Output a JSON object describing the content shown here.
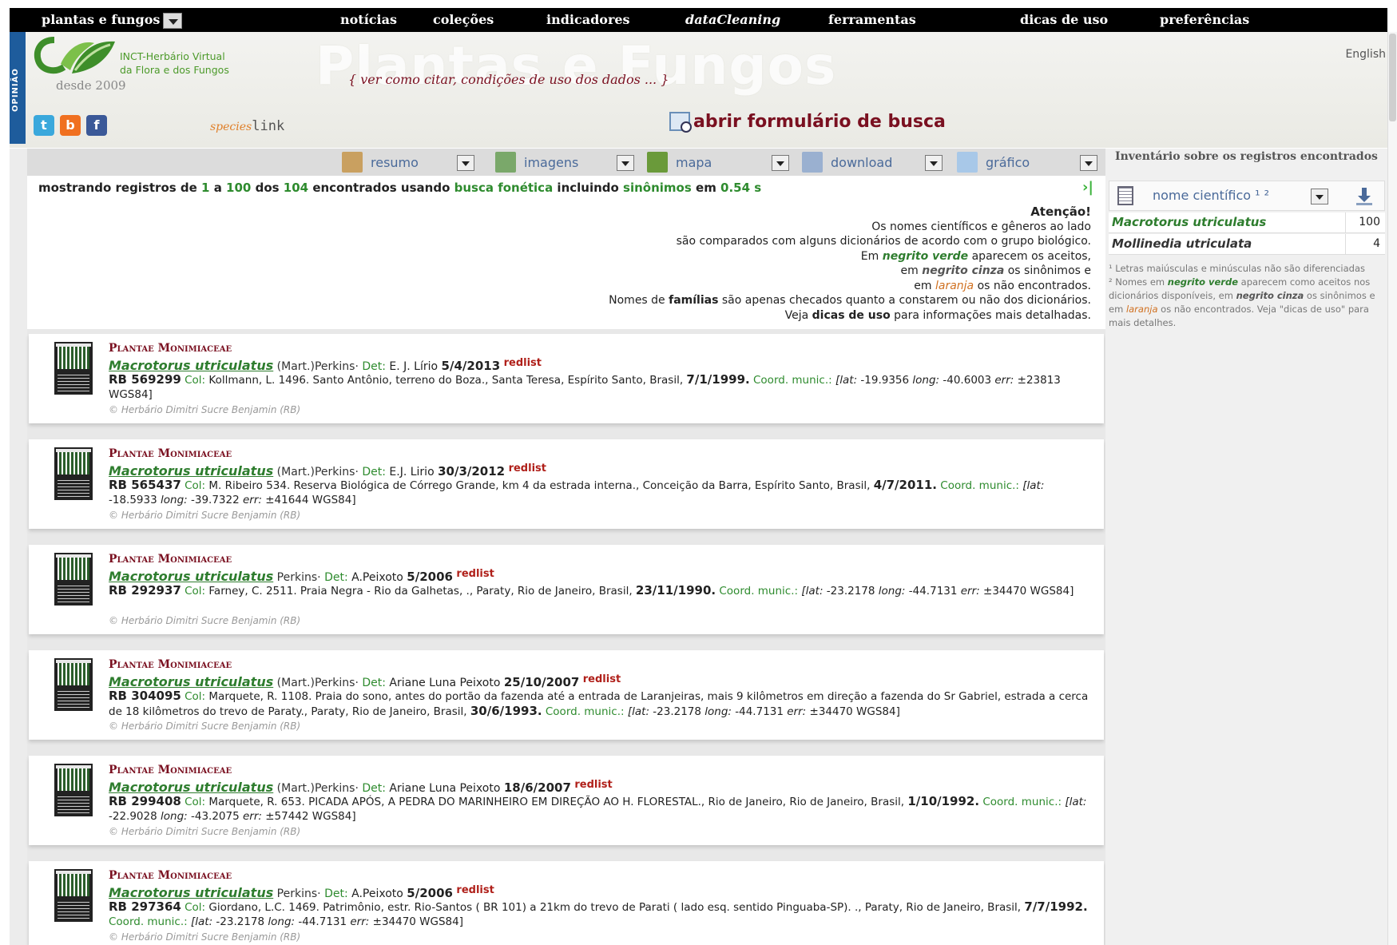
{
  "topnav": {
    "items": [
      "plantas e fungos",
      "notícias",
      "coleções",
      "indicadores",
      "dataCleaning",
      "ferramentas",
      "dicas de uso",
      "preferências"
    ]
  },
  "header": {
    "opiniao": "OPINIÃO",
    "logo_line1": "INCT-Herbário Virtual",
    "logo_line2": "da Flora e dos Fungos",
    "since": "desde 2009",
    "big_title": "Plantas e Fungos",
    "cite": "{ ver como citar, condições de uso dos dados ... }",
    "language": "English",
    "social": [
      "t",
      "b",
      "f"
    ],
    "specieslink_prefix": "species",
    "specieslink_suffix": "link",
    "search_form": "abrir formulário de busca"
  },
  "toolbar": {
    "tools": [
      {
        "label": "resumo",
        "icon": "summary-icon",
        "color": "#c9a060"
      },
      {
        "label": "imagens",
        "icon": "image-icon",
        "color": "#7aa86a"
      },
      {
        "label": "mapa",
        "icon": "map-icon",
        "color": "#6a9a3a"
      },
      {
        "label": "download",
        "icon": "download-icon",
        "color": "#9ab0d0"
      },
      {
        "label": "gráfico",
        "icon": "chart-icon",
        "color": "#a8c8e8"
      }
    ]
  },
  "status": {
    "p1": "mostrando registros de ",
    "from": "1",
    "p2": " a ",
    "to": "100",
    "p3": " dos ",
    "total": "104",
    "p4": " encontrados usando ",
    "mode": "busca fonética",
    "p5": " incluindo ",
    "syn": "sinônimos",
    "p6": " em ",
    "time": "0.54 s",
    "next": "›|"
  },
  "attention": {
    "title": "Atenção!",
    "l1": "Os nomes científicos e gêneros ao lado",
    "l2": "são comparados com alguns dicionários de acordo com o grupo biológico.",
    "l3a": "Em ",
    "l3b": "negrito verde",
    "l3c": " aparecem os aceitos,",
    "l4a": "em ",
    "l4b": "negrito cinza",
    "l4c": " os sinônimos e",
    "l5a": "em ",
    "l5b": "laranja",
    "l5c": " os não encontrados.",
    "l6a": "Nomes de ",
    "l6b": "famílias",
    "l6c": " são apenas checados quanto a constarem ou não dos dicionários.",
    "l7a": "Veja ",
    "l7b": "dicas de uso",
    "l7c": " para informações mais detalhadas."
  },
  "records": [
    {
      "family": "Plantae Monimiaceae",
      "sci": "Macrotorus utriculatus",
      "author": " (Mart.)Perkins· ",
      "det": "Det: ",
      "det_name": "E. J. Lírio ",
      "det_date": "5/4/2013",
      "redlist": "redlist",
      "catalog": "RB 569299",
      "col": " Col: ",
      "desc": "Kollmann, L. 1496. Santo Antônio, terreno do Boza., Santa Teresa, Espírito Santo, Brasil, ",
      "edate": "7/1/1999.",
      "coord": " Coord. munic.: ",
      "lat_lbl": "[lat:",
      "lat": " -19.9356 ",
      "long_lbl": "long:",
      "long": " -40.6003 ",
      "err_lbl": "err:",
      "err": " ±23813 WGS84]",
      "herb": "© Herbário Dimitri Sucre Benjamin (RB)"
    },
    {
      "family": "Plantae Monimiaceae",
      "sci": "Macrotorus utriculatus",
      "author": " (Mart.)Perkins· ",
      "det": "Det: ",
      "det_name": "E.J. Lirio ",
      "det_date": "30/3/2012",
      "redlist": "redlist",
      "catalog": "RB 565437",
      "col": " Col: ",
      "desc": "M. Ribeiro 534. Reserva Biológica de Córrego Grande, km 4 da estrada interna., Conceição da Barra, Espírito Santo, Brasil, ",
      "edate": "4/7/2011.",
      "coord": " Coord. munic.: ",
      "lat_lbl": "[lat:",
      "lat": " -18.5933 ",
      "long_lbl": "long:",
      "long": " -39.7322 ",
      "err_lbl": "err:",
      "err": " ±41644 WGS84]",
      "herb": "© Herbário Dimitri Sucre Benjamin (RB)"
    },
    {
      "family": "Plantae Monimiaceae",
      "sci": "Macrotorus utriculatus",
      "author": " Perkins· ",
      "det": "Det: ",
      "det_name": "A.Peixoto ",
      "det_date": "5/2006",
      "redlist": "redlist",
      "catalog": "RB 292937",
      "col": " Col: ",
      "desc": "Farney, C. 2511. Praia Negra - Rio da Galhetas, ., Paraty, Rio de Janeiro, Brasil, ",
      "edate": "23/11/1990.",
      "coord": " Coord. munic.: ",
      "lat_lbl": "[lat:",
      "lat": " -23.2178 ",
      "long_lbl": "long:",
      "long": " -44.7131 ",
      "err_lbl": "err:",
      "err": " ±34470 WGS84]",
      "herb": "© Herbário Dimitri Sucre Benjamin (RB)"
    },
    {
      "family": "Plantae Monimiaceae",
      "sci": "Macrotorus utriculatus",
      "author": " (Mart.)Perkins· ",
      "det": "Det: ",
      "det_name": "Ariane Luna Peixoto ",
      "det_date": "25/10/2007",
      "redlist": "redlist",
      "catalog": "RB 304095",
      "col": " Col: ",
      "desc": "Marquete, R. 1108. Praia do sono, antes do portão da fazenda até a entrada de Laranjeiras, mais 9 kilômetros em direção a fazenda do Sr Gabriel, estrada a cerca de 18 kilômetros do trevo de Paraty., Paraty, Rio de Janeiro, Brasil, ",
      "edate": "30/6/1993.",
      "coord": " Coord. munic.: ",
      "lat_lbl": "[lat:",
      "lat": " -23.2178 ",
      "long_lbl": "long:",
      "long": " -44.7131 ",
      "err_lbl": "err:",
      "err": " ±34470 WGS84]",
      "herb": "© Herbário Dimitri Sucre Benjamin (RB)"
    },
    {
      "family": "Plantae Monimiaceae",
      "sci": "Macrotorus utriculatus",
      "author": " (Mart.)Perkins· ",
      "det": "Det: ",
      "det_name": "Ariane Luna Peixoto ",
      "det_date": "18/6/2007",
      "redlist": "redlist",
      "catalog": "RB 299408",
      "col": " Col: ",
      "desc": "Marquete, R. 653. PICADA APÓS, A PEDRA DO MARINHEIRO EM DIREÇÃO AO H. FLORESTAL., Rio de Janeiro, Rio de Janeiro, Brasil, ",
      "edate": "1/10/1992.",
      "coord": " Coord. munic.: ",
      "lat_lbl": "[lat:",
      "lat": " -22.9028 ",
      "long_lbl": "long:",
      "long": " -43.2075 ",
      "err_lbl": "err:",
      "err": " ±57442 WGS84]",
      "herb": "© Herbário Dimitri Sucre Benjamin (RB)"
    },
    {
      "family": "Plantae Monimiaceae",
      "sci": "Macrotorus utriculatus",
      "author": " Perkins· ",
      "det": "Det: ",
      "det_name": "A.Peixoto ",
      "det_date": "5/2006",
      "redlist": "redlist",
      "catalog": "RB 297364",
      "col": " Col: ",
      "desc": "Giordano, L.C. 1469. Patrimônio, estr. Rio-Santos ( BR 101) a 21km do trevo de Parati ( lado esq. sentido Pinguaba-SP). ., Paraty, Rio de Janeiro, Brasil, ",
      "edate": "7/7/1992.",
      "coord": " Coord. munic.: ",
      "lat_lbl": "[lat:",
      "lat": " -23.2178 ",
      "long_lbl": "long:",
      "long": " -44.7131 ",
      "err_lbl": "err:",
      "err": " ±34470 WGS84]",
      "herb": "© Herbário Dimitri Sucre Benjamin (RB)"
    }
  ],
  "inventory": {
    "title": "Inventário sobre os registros encontrados",
    "select": "nome científico ¹ ²",
    "rows": [
      {
        "name": "Macrotorus utriculatus",
        "count": "100",
        "status": "accepted"
      },
      {
        "name": "Mollinedia utriculata",
        "count": "4",
        "status": "synonym"
      }
    ],
    "note1": "¹ Letras maiúsculas e minúsculas não são diferenciadas",
    "note2a": "² Nomes em ",
    "note2b": "negrito verde",
    "note2c": " aparecem como aceitos nos dicionários disponíveis, em ",
    "note2d": "negrito cinza",
    "note2e": " os sinônimos e em ",
    "note2f": "laranja",
    "note2g": " os não encontrados. Veja \"dicas de uso\" para mais detalhes."
  }
}
